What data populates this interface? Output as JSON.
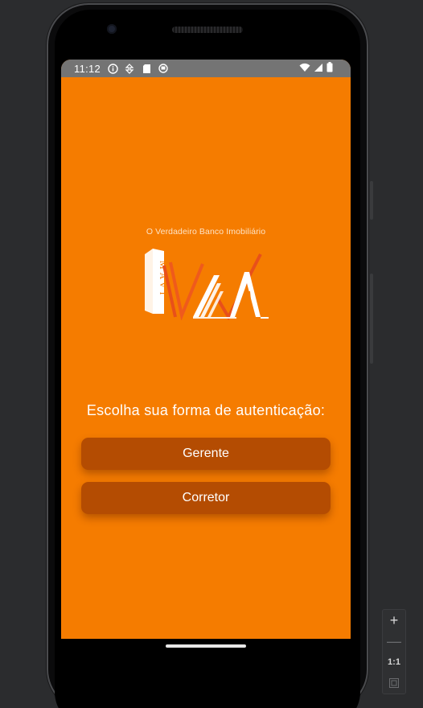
{
  "status_bar": {
    "time": "11:12",
    "left_icons": [
      "info-icon",
      "data-saver-icon",
      "sd-card-icon",
      "sync-icon"
    ],
    "right_icons": [
      "wifi-icon",
      "cell-signal-icon",
      "battery-icon"
    ]
  },
  "app": {
    "tagline": "O Verdadeiro Banco Imobiliário",
    "logo_text": "MAVI",
    "prompt": "Escolha sua forma de autenticação:",
    "buttons": {
      "gerente": "Gerente",
      "corretor": "Corretor"
    },
    "colors": {
      "background": "#f57c00",
      "button": "#b44c02",
      "text": "#ffffff"
    }
  },
  "emulator_toolbar": {
    "zoom_in": "+",
    "zoom_out": "—",
    "actual_size": "1:1",
    "fit_icon": "fit-screen-icon"
  }
}
